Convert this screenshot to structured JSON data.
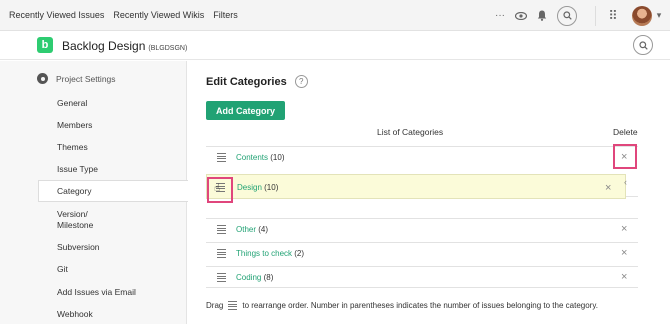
{
  "topnav": {
    "items": [
      "Recently Viewed Issues",
      "Recently Viewed Wikis",
      "Filters"
    ]
  },
  "topicons": {
    "more": "···",
    "watch_icon": "eye-icon",
    "bell_icon": "bell-icon",
    "apps": "⠿",
    "caret": "▾"
  },
  "project": {
    "logo_letter": "b",
    "name": "Backlog Design",
    "key": "(BLGDSGN)"
  },
  "sidebar": {
    "title": "Project Settings",
    "items": [
      {
        "label": "General"
      },
      {
        "label": "Members"
      },
      {
        "label": "Themes"
      },
      {
        "label": "Issue Type"
      },
      {
        "label": "Category"
      },
      {
        "label": "Version/"
      },
      {
        "label": "Milestone"
      },
      {
        "label": "Subversion"
      },
      {
        "label": "Git"
      },
      {
        "label": "Add Issues via Email"
      },
      {
        "label": "Webhook"
      }
    ]
  },
  "main": {
    "title": "Edit Categories",
    "help": "?",
    "add_button": "Add Category",
    "col_list": "List of Categories",
    "col_delete": "Delete",
    "delete_glyph": "×",
    "categories": [
      {
        "name": "Contents",
        "count": "(10)"
      },
      {
        "name": "Design",
        "count": "(10)"
      },
      {
        "name": "Other",
        "count": "(4)"
      },
      {
        "name": "Things to check",
        "count": "(2)"
      },
      {
        "name": "Coding",
        "count": "(8)"
      }
    ],
    "footer_pre": "Drag",
    "footer_post": "to rearrange order. Number in parentheses indicates the number of issues belonging to the category."
  },
  "colors": {
    "accent": "#21a274",
    "highlight": "#e0467c",
    "drag_bg": "#fbfbd9"
  }
}
